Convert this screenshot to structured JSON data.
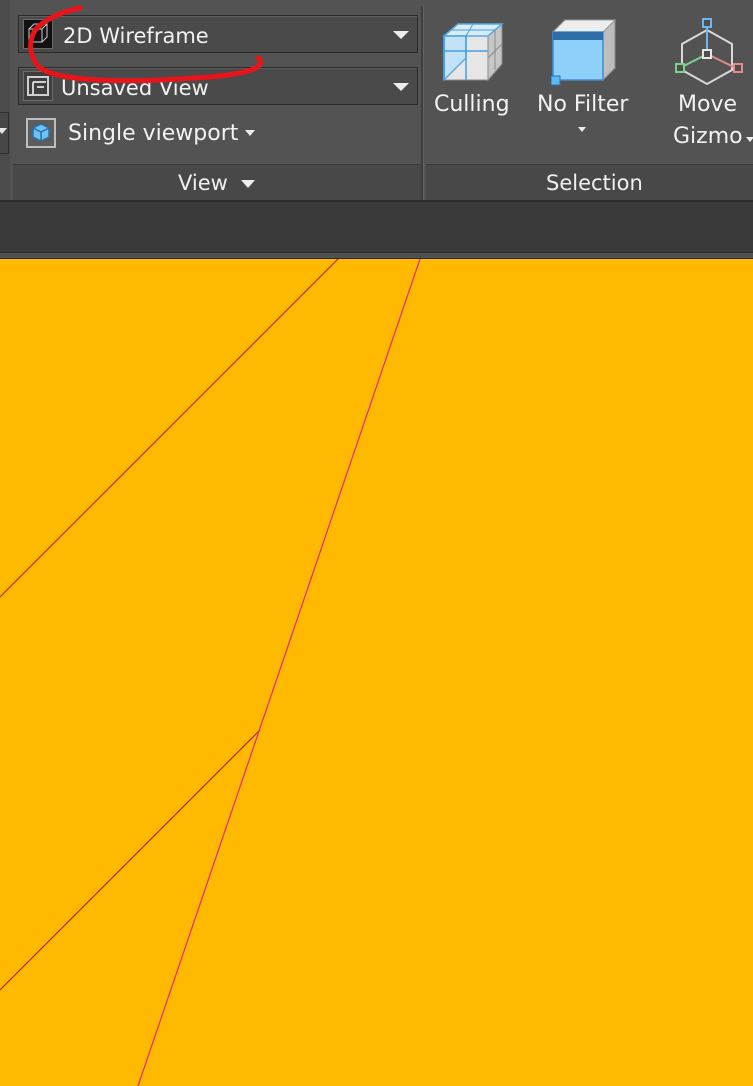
{
  "ribbon": {
    "view_panel": {
      "visual_style_dropdown": {
        "value": "2D Wireframe"
      },
      "named_view_dropdown": {
        "value": "Unsaved View"
      },
      "viewport_config": {
        "label": "Single viewport"
      },
      "footer_label": "View"
    },
    "selection_panel": {
      "culling": {
        "label": "Culling"
      },
      "no_filter": {
        "label": "No Filter"
      },
      "move_gizmo": {
        "label_line1": "Move",
        "label_line2": "Gizmo"
      },
      "footer_label": "Selection"
    }
  },
  "colors": {
    "viewport_background": "#ffba00",
    "ribbon_background": "#535353",
    "annotation_stroke": "#e8141c",
    "line_dark_red": "#c0281a",
    "line_magenta": "#e8307a"
  },
  "icons": {
    "visual_style": "wireframe-cube-icon",
    "named_view": "view-manager-icon",
    "viewport": "viewport-cube-icon",
    "culling": "culling-cube-icon",
    "no_filter": "filter-box-icon",
    "move_gizmo": "move-gizmo-icon"
  }
}
